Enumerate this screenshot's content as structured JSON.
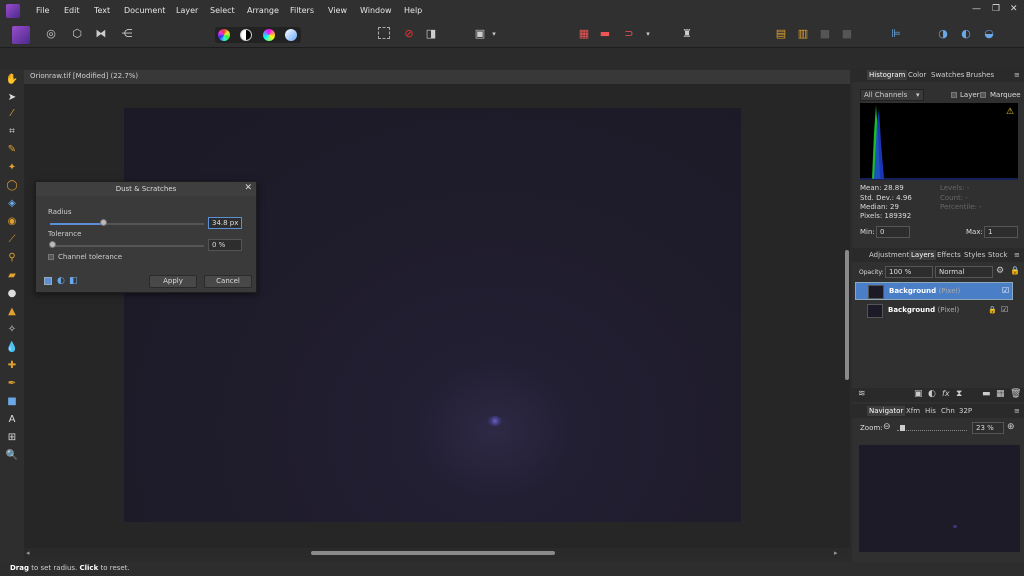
{
  "menu": [
    "File",
    "Edit",
    "Text",
    "Document",
    "Layer",
    "Select",
    "Arrange",
    "Filters",
    "View",
    "Window",
    "Help"
  ],
  "window_controls": {
    "minimize": "—",
    "restore": "❐",
    "close": "✕"
  },
  "document": {
    "tab_title": "Orionraw.tif [Modified] (22.7%)"
  },
  "dialog": {
    "title": "Dust & Scratches",
    "radius_label": "Radius",
    "radius_value": "34.8 px",
    "radius_fraction": 0.35,
    "tolerance_label": "Tolerance",
    "tolerance_value": "0 %",
    "tolerance_fraction": 0.0,
    "channel_tolerance_label": "Channel tolerance",
    "apply": "Apply",
    "cancel": "Cancel"
  },
  "histogram_panel": {
    "tabs": [
      "Histogram",
      "Color",
      "Swatches",
      "Brushes"
    ],
    "channels": "All Channels",
    "layer_label": "Layer",
    "marquee_label": "Marquee",
    "mean": "Mean: 28.89",
    "std_dev": "Std. Dev.: 4.96",
    "median": "Median: 29",
    "pixels": "Pixels: 189392",
    "levels": "Levels: -",
    "count": "Count: -",
    "percentile": "Percentile: -",
    "min_label": "Min:",
    "min_value": "0",
    "max_label": "Max:",
    "max_value": "1"
  },
  "layers_panel": {
    "tabs": [
      "Adjustment",
      "Layers",
      "Effects",
      "Styles",
      "Stock"
    ],
    "opacity_label": "Opacity:",
    "opacity_value": "100 %",
    "blend_mode": "Normal",
    "layers": [
      {
        "name": "Background",
        "type": "(Pixel)",
        "selected": true
      },
      {
        "name": "Background",
        "type": "(Pixel)",
        "selected": false,
        "locked": true
      }
    ]
  },
  "navigator_panel": {
    "tabs": [
      "Navigator",
      "Xfm",
      "His",
      "Chn",
      "32P"
    ],
    "zoom_label": "Zoom:",
    "zoom_value": "23 %"
  },
  "status": {
    "drag": "Drag",
    "text1": " to set radius. ",
    "click": "Click",
    "text2": " to reset."
  },
  "colors": {
    "accent": "#5c8fd6",
    "selected_layer": "#4a7fc8"
  }
}
